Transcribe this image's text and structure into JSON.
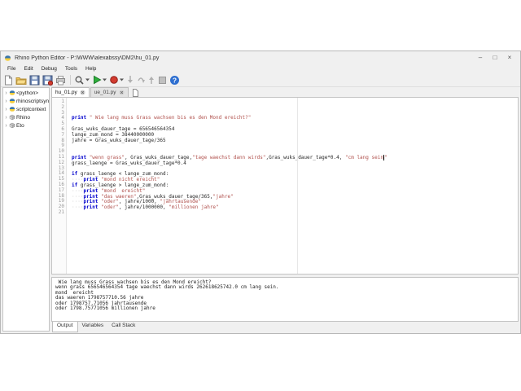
{
  "window": {
    "title": "Rhino Python Editor - P:\\WWW\\alexabssy\\DM2\\hu_01.py",
    "controls": {
      "minimize": "–",
      "maximize": "□",
      "close": "×"
    }
  },
  "menu": {
    "items": [
      "File",
      "Edit",
      "Debug",
      "Tools",
      "Help"
    ]
  },
  "toolbar": {
    "icons": [
      {
        "name": "new-file-icon"
      },
      {
        "name": "open-folder-icon"
      },
      {
        "name": "save-icon"
      },
      {
        "name": "save-all-icon"
      },
      {
        "name": "print-icon"
      },
      {
        "name": "search-icon",
        "dropdown": true
      },
      {
        "name": "run-icon",
        "dropdown": true
      },
      {
        "name": "breakpoint-icon",
        "dropdown": true
      },
      {
        "name": "step-into-icon"
      },
      {
        "name": "step-over-icon"
      },
      {
        "name": "step-out-icon"
      },
      {
        "name": "stop-icon"
      },
      {
        "name": "help-icon"
      }
    ]
  },
  "sidebar": {
    "items": [
      {
        "label": "<python>",
        "icon": "python-icon",
        "arrow": "›"
      },
      {
        "label": "rhinoscriptsyntax",
        "icon": "python-icon",
        "arrow": "›"
      },
      {
        "label": "scriptcontext",
        "icon": "python-icon",
        "arrow": "›"
      },
      {
        "label": "Rhino",
        "icon": "module-icon",
        "arrow": "›"
      },
      {
        "label": "Eto",
        "icon": "module-icon",
        "arrow": "›"
      }
    ]
  },
  "file_tabs": [
    {
      "label": "hu_01.py",
      "active": true,
      "closable": true
    },
    {
      "label": "ue_01.py",
      "active": false,
      "closable": true
    }
  ],
  "editor": {
    "lines": [
      {
        "n": 1,
        "seg": [
          [
            "k",
            "print"
          ],
          [
            "p",
            " "
          ],
          [
            "s",
            "\" Wie lang muss Grass wachsen bis es den Mond ereicht?\""
          ]
        ]
      },
      {
        "n": 2,
        "seg": []
      },
      {
        "n": 3,
        "seg": [
          [
            "p",
            "Gras_wuks_dauer_tage = 656546564354"
          ]
        ]
      },
      {
        "n": 4,
        "seg": [
          [
            "p",
            "lange_zum_mond = 38440000000"
          ]
        ]
      },
      {
        "n": 5,
        "seg": [
          [
            "p",
            "jahre = Gras_wuks_dauer_tage/365"
          ]
        ]
      },
      {
        "n": 6,
        "seg": []
      },
      {
        "n": 7,
        "seg": []
      },
      {
        "n": 8,
        "seg": [
          [
            "k",
            "print"
          ],
          [
            "p",
            " "
          ],
          [
            "s",
            "\"wenn grass\""
          ],
          [
            "p",
            ", Gras_wuks_dauer_tage,"
          ],
          [
            "s",
            "\"tage waechst dann wirds\""
          ],
          [
            "p",
            ",Gras_wuks_dauer_tage*0.4, "
          ],
          [
            "s",
            "\"cm lang sein"
          ],
          [
            "caret",
            ""
          ],
          [
            "s",
            "\""
          ]
        ]
      },
      {
        "n": 9,
        "seg": [
          [
            "p",
            "grass_laenge = Gras_wuks_dauer_tage*0.4"
          ]
        ]
      },
      {
        "n": 10,
        "seg": []
      },
      {
        "n": 11,
        "seg": [
          [
            "k",
            "if"
          ],
          [
            "p",
            " grass_laenge < lange_zum_mond:"
          ]
        ]
      },
      {
        "n": 12,
        "seg": [
          [
            "w",
            "····"
          ],
          [
            "k",
            "print"
          ],
          [
            "p",
            " "
          ],
          [
            "s",
            "\"mond nicht ereicht\""
          ]
        ]
      },
      {
        "n": 13,
        "seg": [
          [
            "k",
            "if"
          ],
          [
            "p",
            " grass_laenge > lange_zum_mond:"
          ]
        ]
      },
      {
        "n": 14,
        "seg": [
          [
            "w",
            "····"
          ],
          [
            "k",
            "print"
          ],
          [
            "p",
            " "
          ],
          [
            "s",
            "\"mond  ereicht\""
          ]
        ]
      },
      {
        "n": 15,
        "seg": [
          [
            "w",
            "····"
          ],
          [
            "k",
            "print"
          ],
          [
            "p",
            " "
          ],
          [
            "s",
            "\"das waeren\""
          ],
          [
            "p",
            ",Gras_wuks_dauer_tage/365,"
          ],
          [
            "s",
            "\"jahre\""
          ]
        ]
      },
      {
        "n": 16,
        "seg": [
          [
            "w",
            "····"
          ],
          [
            "k",
            "print"
          ],
          [
            "p",
            " "
          ],
          [
            "s",
            "\"oder\""
          ],
          [
            "p",
            ", jahre/1000, "
          ],
          [
            "s",
            "\"jahrtausende\""
          ]
        ]
      },
      {
        "n": 17,
        "seg": [
          [
            "w",
            "····"
          ],
          [
            "k",
            "print"
          ],
          [
            "p",
            " "
          ],
          [
            "s",
            "\"oder\""
          ],
          [
            "p",
            ", jahre/1000000, "
          ],
          [
            "s",
            "\"millionen jahre\""
          ]
        ]
      },
      {
        "n": 18,
        "seg": []
      },
      {
        "n": 19,
        "seg": []
      },
      {
        "n": 20,
        "seg": []
      },
      {
        "n": 21,
        "seg": []
      }
    ]
  },
  "output": {
    "lines": [
      " Wie lang muss Grass wachsen bis es den Mond ereicht?",
      "wenn grass 656546564354 tage waechst dann wirds 262618625742.0 cm lang sein.",
      "mond  ereicht",
      "das waeren 1798757710.56 jahre",
      "oder 1798757.71056 jahrtausende",
      "oder 1798.75771056 millionen jahre"
    ]
  },
  "bottom_tabs": [
    {
      "label": "Output",
      "active": true
    },
    {
      "label": "Variables",
      "active": false
    },
    {
      "label": "Call Stack",
      "active": false
    }
  ],
  "colors": {
    "keyword": "#0000cc",
    "string": "#b0504c",
    "run_green": "#2fae3c",
    "breakpoint_red": "#d23b2f",
    "help_blue": "#2e6fd0",
    "chrome": "#f0f0f0"
  }
}
